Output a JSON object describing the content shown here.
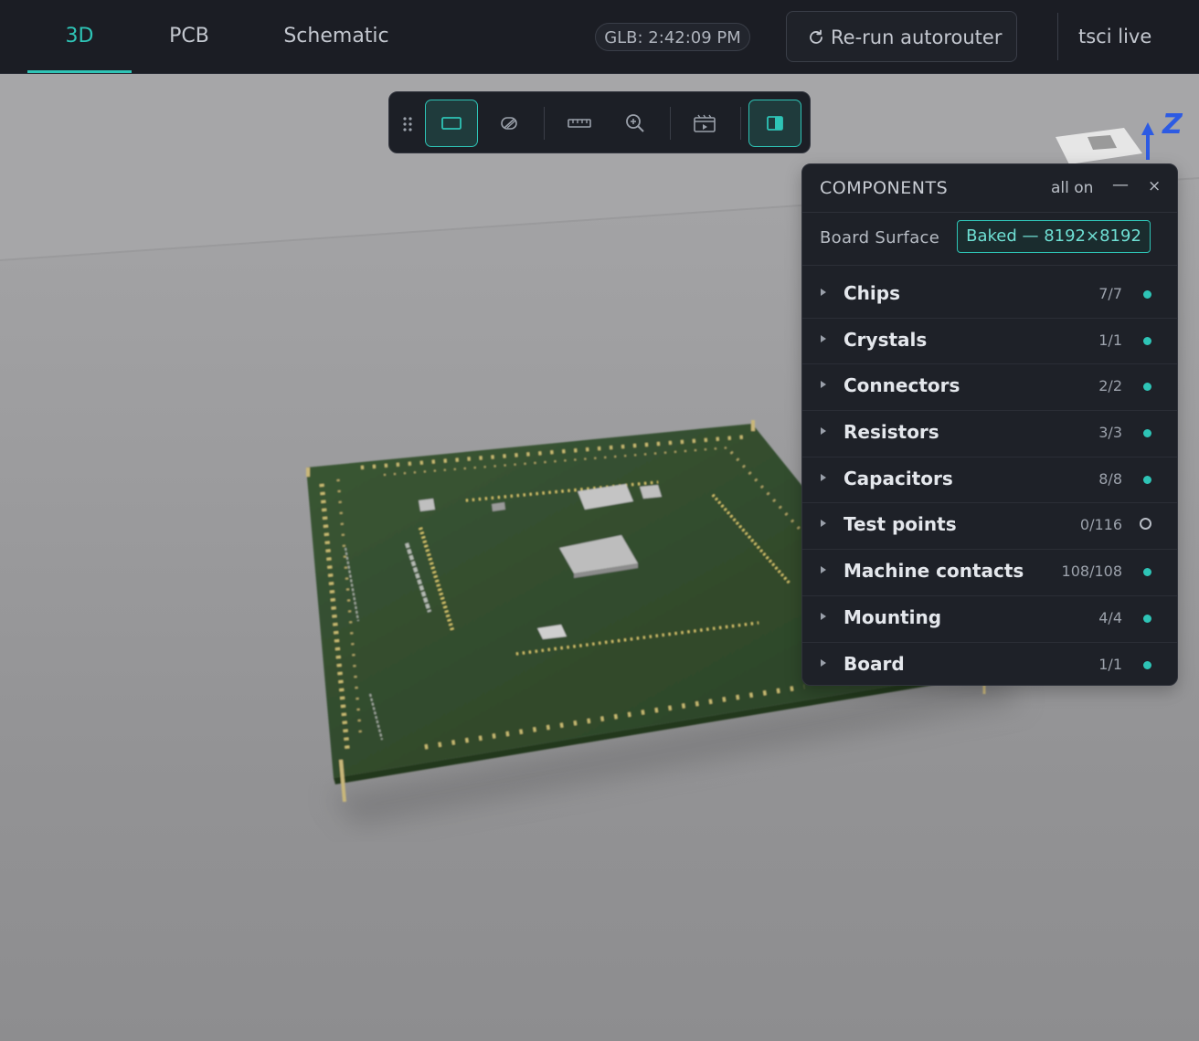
{
  "tabs": [
    {
      "label": "3D",
      "active": true
    },
    {
      "label": "PCB",
      "active": false
    },
    {
      "label": "Schematic",
      "active": false
    }
  ],
  "header": {
    "glb_status": "GLB: 2:42:09 PM",
    "rerun_label": "Re-run autorouter",
    "live_label": "tsci live"
  },
  "toolbar": {
    "icons": [
      "drag-grip-icon",
      "box-view-icon",
      "visibility-toggle-icon",
      "ruler-icon",
      "zoom-icon",
      "animation-icon",
      "side-panel-icon"
    ]
  },
  "axis_gizmo": {
    "label": "Z"
  },
  "panel": {
    "title": "COMPONENTS",
    "all_on": "all on",
    "minimize": "—",
    "close": "×",
    "surface_label": "Board Surface",
    "surface_value": "Baked — 8192×8192",
    "rows": [
      {
        "name": "Chips",
        "count": "7/7",
        "on": true
      },
      {
        "name": "Crystals",
        "count": "1/1",
        "on": true
      },
      {
        "name": "Connectors",
        "count": "2/2",
        "on": true
      },
      {
        "name": "Resistors",
        "count": "3/3",
        "on": true
      },
      {
        "name": "Capacitors",
        "count": "8/8",
        "on": true
      },
      {
        "name": "Test points",
        "count": "0/116",
        "on": false
      },
      {
        "name": "Machine contacts",
        "count": "108/108",
        "on": true
      },
      {
        "name": "Mounting",
        "count": "4/4",
        "on": true
      },
      {
        "name": "Board",
        "count": "1/1",
        "on": true
      }
    ]
  },
  "colors": {
    "accent": "#2ec4b6",
    "topbar_bg": "#1b1d24",
    "panel_bg": "#1e2128",
    "board_green": "#2f4a2a"
  }
}
